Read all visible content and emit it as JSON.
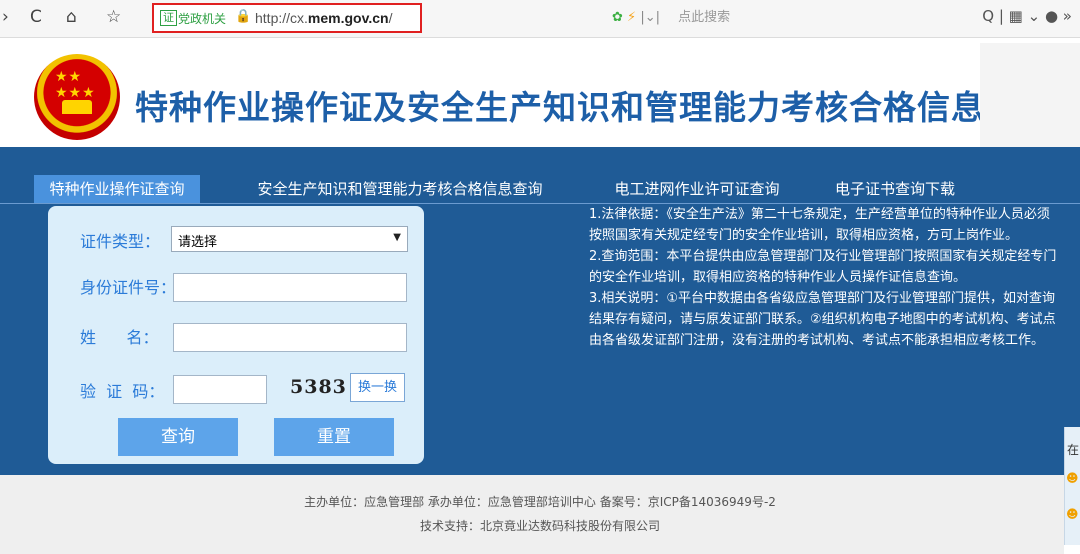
{
  "browser": {
    "nav_back": "›",
    "nav_refresh": "C",
    "nav_home": "⌂",
    "nav_star": "☆",
    "url_badge": "证",
    "url_label": "党政机关",
    "url_prefix": "http://cx.",
    "url_domain": "mem.gov.cn",
    "url_suffix": "/",
    "search_placeholder": "点此搜索",
    "right_icons": "Q | ▦ ⌄ ● »"
  },
  "header": {
    "title": "特种作业操作证及安全生产知识和管理能力考核合格信息查询平台"
  },
  "tabs": [
    {
      "label": "特种作业操作证查询",
      "active": true
    },
    {
      "label": "安全生产知识和管理能力考核合格信息查询",
      "active": false
    },
    {
      "label": "电工进网作业许可证查询",
      "active": false
    },
    {
      "label": "电子证书查询下载",
      "active": false
    }
  ],
  "form": {
    "id_type_label": "证件类型：",
    "id_type_value": "请选择",
    "id_number_label": "身份证件号：",
    "name_label": "姓      名：",
    "captcha_label": "验  证  码：",
    "captcha_code": "5383",
    "refresh_label": "换一换",
    "query_button": "查询",
    "reset_button": "重置"
  },
  "info": {
    "para1": "1.法律依据：《安全生产法》第二十七条规定，生产经营单位的特种作业人员必须按照国家有关规定经专门的安全作业培训，取得相应资格，方可上岗作业。",
    "para2": "2.查询范围：本平台提供由应急管理部门及行业管理部门按照国家有关规定经专门的安全作业培训，取得相应资格的特种作业人员操作证信息查询。",
    "para3": "3.相关说明：①平台中数据由各省级应急管理部门及行业管理部门提供，如对查询结果存有疑问，请与原发证部门联系。②组织机构电子地图中的考试机构、考试点由各省级发证部门注册，没有注册的考试机构、考试点不能承担相应考核工作。"
  },
  "side_float": {
    "label": "在"
  },
  "footer": {
    "line1": "主办单位：应急管理部   承办单位：应急管理部培训中心   备案号：京ICP备14036949号-2",
    "line2": "技术支持：北京竟业达数码科技股份有限公司"
  },
  "colors": {
    "main_bg": "#1f5b96",
    "active_tab": "#4a92dd",
    "title_blue": "#1d5fa8",
    "button_blue": "#5da4ea",
    "url_border": "#e02020"
  }
}
